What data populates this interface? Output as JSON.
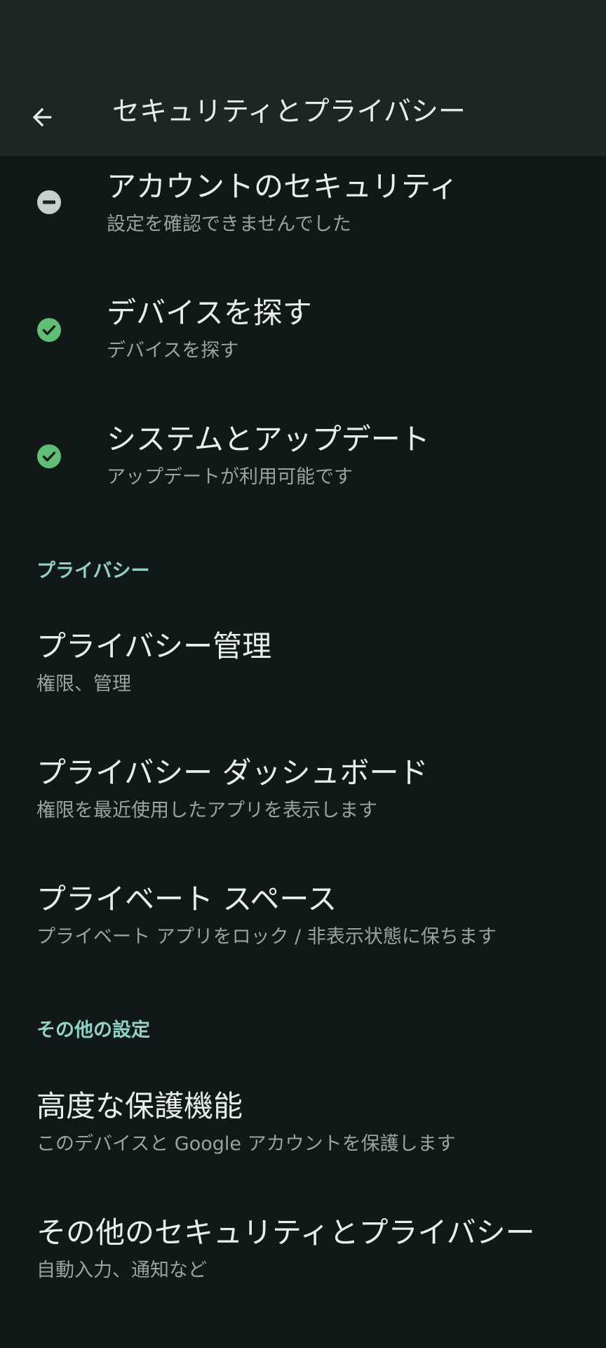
{
  "header": {
    "title": "セキュリティとプライバシー",
    "back_icon": "arrow-back-icon"
  },
  "status_items": [
    {
      "title": "アカウントのセキュリティ",
      "subtitle": "設定を確認できませんでした",
      "status_icon": "minus-circle-icon"
    },
    {
      "title": "デバイスを探す",
      "subtitle": "デバイスを探す",
      "status_icon": "check-circle-icon"
    },
    {
      "title": "システムとアップデート",
      "subtitle": "アップデートが利用可能です",
      "status_icon": "check-circle-icon"
    }
  ],
  "privacy_section": {
    "header": "プライバシー",
    "items": [
      {
        "title": "プライバシー管理",
        "subtitle": "権限、管理"
      },
      {
        "title": "プライバシー ダッシュボード",
        "subtitle": "権限を最近使用したアプリを表示します"
      },
      {
        "title": "プライベート スペース",
        "subtitle": "プライベート アプリをロック / 非表示状態に保ちます"
      }
    ]
  },
  "other_section": {
    "header": "その他の設定",
    "items": [
      {
        "title": "高度な保護機能",
        "subtitle": "このデバイスと Google アカウントを保護します"
      },
      {
        "title": "その他のセキュリティとプライバシー",
        "subtitle": "自動入力、通知など"
      }
    ]
  },
  "colors": {
    "background": "#111818",
    "top_bar": "#1d2525",
    "accent": "#8fd2c6",
    "check_green": "#5fc075",
    "neutral_icon": "#c9cfce"
  }
}
